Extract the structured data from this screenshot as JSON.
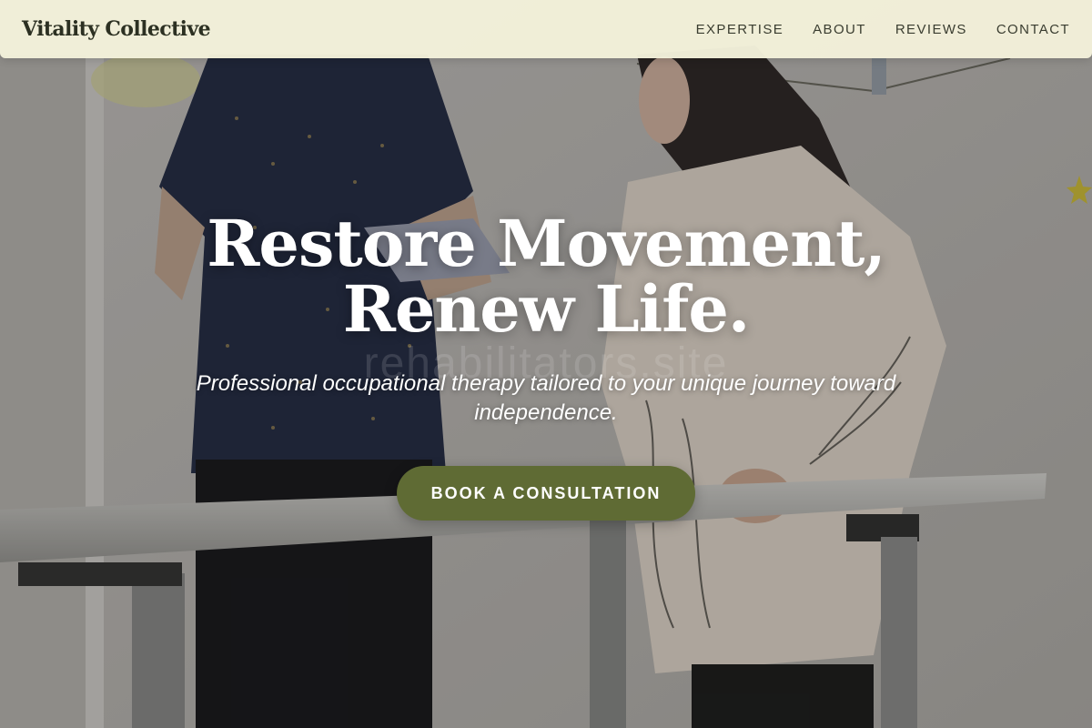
{
  "nav": {
    "brand": "Vitality Collective",
    "links": [
      {
        "label": "EXPERTISE"
      },
      {
        "label": "ABOUT"
      },
      {
        "label": "REVIEWS"
      },
      {
        "label": "CONTACT"
      }
    ]
  },
  "hero": {
    "title_line1": "Restore Movement,",
    "title_line2": "Renew Life.",
    "subtitle": "Professional occupational therapy tailored to your unique journey toward independence.",
    "cta_label": "BOOK A CONSULTATION",
    "watermark": "rehabilitators.site"
  },
  "colors": {
    "nav_background": "#f3f1da",
    "accent": "#5f6b34",
    "text_dark": "#2c3022"
  }
}
